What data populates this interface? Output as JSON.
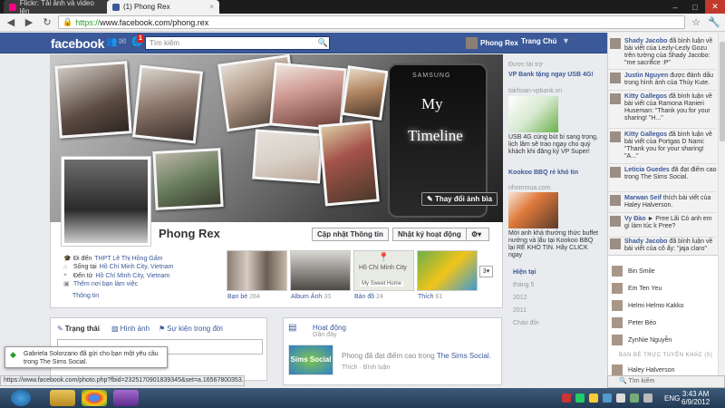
{
  "browser": {
    "tabs": [
      {
        "title": "Flickr: Tải ảnh và video lên",
        "favicon_color": "#ff0084"
      },
      {
        "title": "(1) Phong Rex",
        "favicon_color": "#3b5998"
      }
    ],
    "url_scheme": "https://",
    "url_rest": "www.facebook.com/phong.rex"
  },
  "fb_header": {
    "logo": "facebook",
    "notif_count": "1",
    "search_placeholder": "Tìm kiếm",
    "user_name": "Phong Rex",
    "home_label": "Trang Chủ"
  },
  "cover": {
    "phone_brand": "SAMSUNG",
    "timeline_line1": "My",
    "timeline_line2": "Timeline",
    "change_cover": "Thay đổi ảnh bìa"
  },
  "profile": {
    "name": "Phong Rex",
    "update_info": "Cập nhật Thông tin",
    "activity_log": "Nhật ký hoạt động",
    "info": [
      {
        "prefix": "Đi đến",
        "link": "THPT Lê Thị Hồng Gấm"
      },
      {
        "prefix": "Sống tại",
        "link": "Hồ Chí Minh City, Vietnam"
      },
      {
        "prefix": "Đến từ",
        "link": "Hồ Chí Minh City, Vietnam"
      },
      {
        "prefix": "",
        "link": "Thêm nơi bạn làm việc"
      }
    ],
    "info_link": "Thông tin",
    "apps": [
      {
        "label": "Bạn bè",
        "count": "284"
      },
      {
        "label": "Album Ảnh",
        "count": "33"
      },
      {
        "label": "Bản đồ",
        "count": "24"
      },
      {
        "label": "Thích",
        "count": "61"
      }
    ],
    "map_city": "Hồ Chí Minh City",
    "map_place": "My Sweet Home",
    "apps_more": "3"
  },
  "years": [
    "Hiện tại",
    "tháng 5",
    "2012",
    "2011",
    "Chào đời"
  ],
  "ads": {
    "label": "Được tài trợ",
    "items": [
      {
        "title": "VP Bank tặng ngay USB 4G!",
        "url": "takhoan-vpbank.vn",
        "text": "USB 4G cùng bút bi sang trọng, lịch lâm sẽ trao ngay cho quý khách khi đăng ký VP Super!"
      },
      {
        "title": "Kookoo BBQ rẻ khó tin",
        "url": "nhommua.com",
        "text": "Mời anh khá thưởng thức buffet nướng và lẩu tại Kookoo BBQ lại RẺ KHÓ TIN. Hãy CLICK ngay"
      }
    ]
  },
  "composer": {
    "tabs": [
      "Trạng thái",
      "Hình ảnh",
      "Sự kiện trong đời"
    ]
  },
  "activity": {
    "title": "Hoạt động",
    "subtitle": "Gần đây",
    "text_prefix": "Phong đã đạt điểm cao trong",
    "text_link": "The Sims Social.",
    "meta": "Thích · Bình luận",
    "game_logo": "Sims Social"
  },
  "popup": {
    "text": "Gabriela Solorzano đã gửi cho bạn một yêu cầu trong The Sims Social."
  },
  "statusbar": "https://www.facebook.com/photo.php?fbid=2325170901839345&set=a.16567800353...",
  "ticker": [
    {
      "name": "Shady Jacobo",
      "text": "đã bình luận về bài viết của Lezly-Lezly Gozu trên tường của Shady Jacobo: \"me sacrifice :P\""
    },
    {
      "name": "Justin Nguyen",
      "text": "được đánh dấu trong hình ảnh của Thúy Kute."
    },
    {
      "name": "Kitty Gallegos",
      "text": "đã bình luận về bài viết của Ramona Ranieri Huseman: \"Thank you for your sharing! \"H...\""
    },
    {
      "name": "Kitty Gallegos",
      "text": "đã bình luận về bài viết của Portgas D Nami: \"Thank you for your sharing! \"A...\""
    },
    {
      "name": "Leticia Guedes",
      "text": "đã đạt điểm cao trong The Sims Social."
    },
    {
      "name": "Marwan Seif",
      "text": "thích bài viết của Haley Halverson."
    },
    {
      "name": "Vy Đào",
      "text": "► Pree Lãi Có anh em gì làm túc k Pree?"
    },
    {
      "name": "Shady Jacobo",
      "text": "đã bình luận về bài viết của cô ấy: \"jaja claro\""
    }
  ],
  "chat": {
    "online": [
      "Bin Smile",
      "Em Ten Yeu",
      "Helmi Helmo Kakko",
      "Peter Béo",
      "ZynNie Nguyễn"
    ],
    "section": "BẠN BÈ TRỰC TUYẾN KHÁC (5)",
    "next": "Haley Halverson",
    "search": "Tìm kiếm"
  },
  "taskbar": {
    "lang": "ENG",
    "time": "3:43 AM",
    "date": "6/9/2012"
  }
}
